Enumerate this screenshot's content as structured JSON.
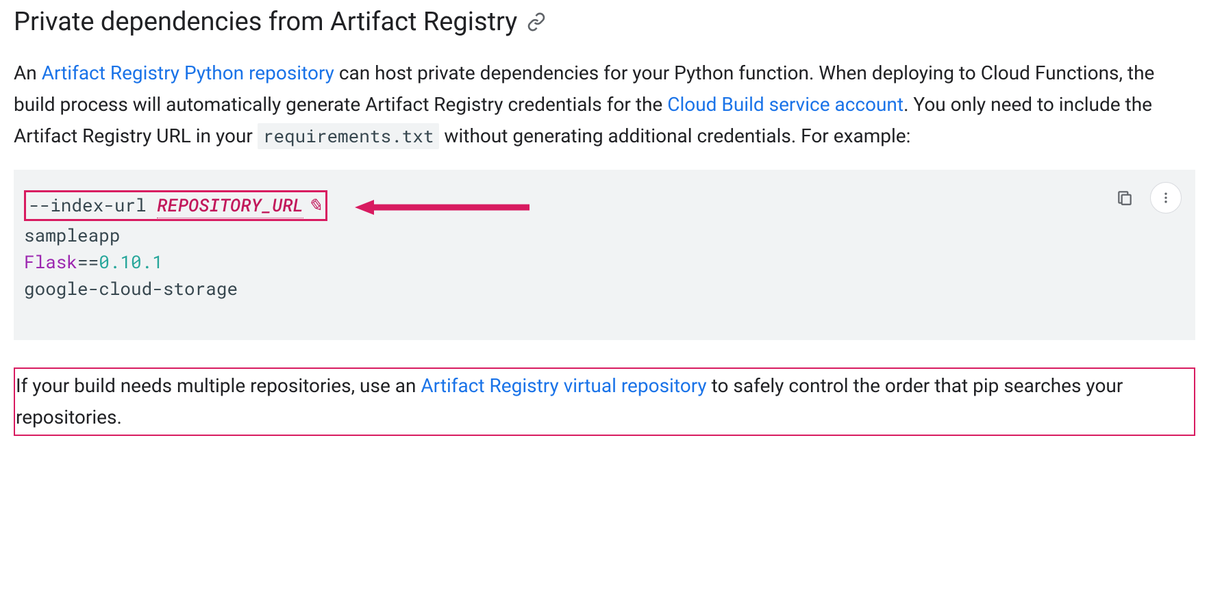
{
  "heading": "Private dependencies from Artifact Registry",
  "intro": {
    "prefix": "An ",
    "link1": "Artifact Registry Python repository",
    "mid1": " can host private dependencies for your Python function. When deploying to Cloud Functions, the build process will automatically generate Artifact Registry credentials for the ",
    "link2": "Cloud Build service account",
    "mid2": ". You only need to include the Artifact Registry URL in your ",
    "code_file": "requirements.txt",
    "suffix": " without generating additional credentials. For example:"
  },
  "code": {
    "line1_prefix": "--index-url ",
    "line1_var": "REPOSITORY_URL",
    "line2": "sampleapp",
    "line3_pkg": "Flask",
    "line3_op": "==",
    "line3_ver": "0.10.1",
    "line4": "google-cloud-storage"
  },
  "boxed": {
    "prefix": "If your build needs multiple repositories, use an ",
    "link": "Artifact Registry virtual repository",
    "suffix": " to safely control the order that pip searches your repositories."
  }
}
